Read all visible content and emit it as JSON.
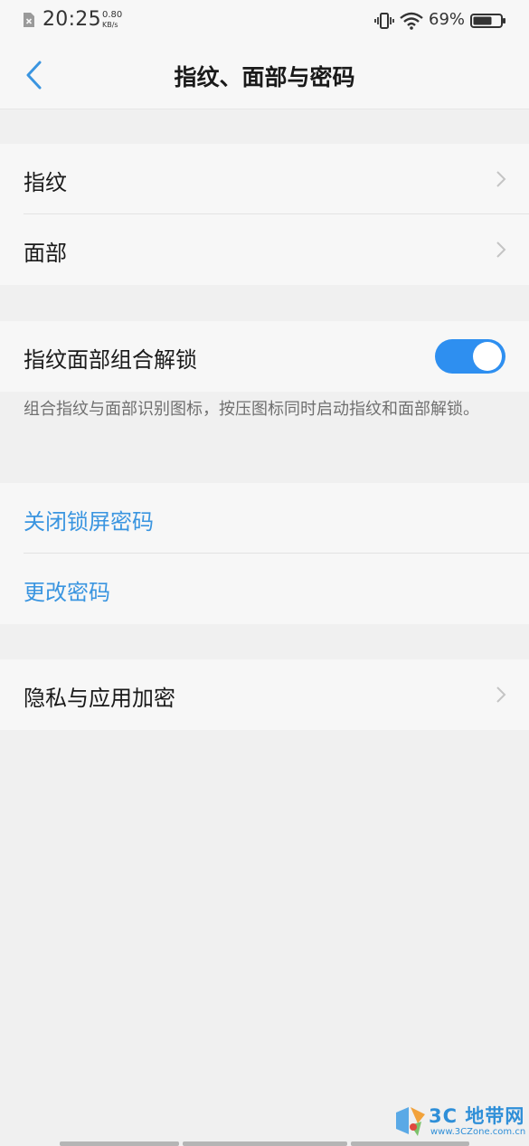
{
  "status_bar": {
    "time": "20:25",
    "net_speed_value": "0.80",
    "net_speed_unit": "KB/s",
    "battery_percent": "69%",
    "battery_level": 0.69
  },
  "header": {
    "title": "指纹、面部与密码"
  },
  "section_biometric": {
    "items": [
      {
        "label": "指纹"
      },
      {
        "label": "面部"
      }
    ]
  },
  "section_combo": {
    "label": "指纹面部组合解锁",
    "toggle_on": true,
    "description": "组合指纹与面部识别图标，按压图标同时启动指纹和面部解锁。"
  },
  "section_password": {
    "items": [
      {
        "label": "关闭锁屏密码"
      },
      {
        "label": "更改密码"
      }
    ]
  },
  "section_privacy": {
    "label": "隐私与应用加密"
  },
  "watermark": {
    "title": "3C 地带网",
    "url": "www.3CZone.com.cn"
  },
  "colors": {
    "accent_blue": "#3a95e0",
    "toggle_blue": "#2e8ff0",
    "page_bg": "#f0f0f0",
    "card_bg": "#f7f7f7"
  }
}
